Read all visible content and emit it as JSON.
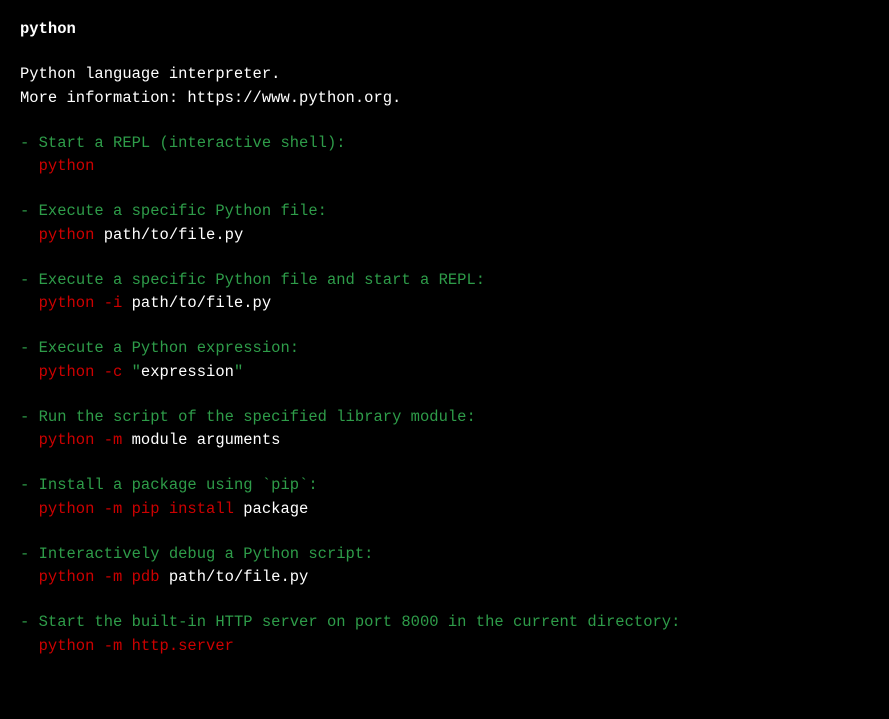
{
  "title": "python",
  "description": {
    "line1": "Python language interpreter.",
    "line2": "More information: https://www.python.org."
  },
  "examples": [
    {
      "desc": "Start a REPL (interactive shell):",
      "cmd": "python",
      "arg": ""
    },
    {
      "desc": "Execute a specific Python file:",
      "cmd": "python ",
      "arg": "path/to/file.py"
    },
    {
      "desc": "Execute a specific Python file and start a REPL:",
      "cmd": "python -i ",
      "arg": "path/to/file.py"
    },
    {
      "desc": "Execute a Python expression:",
      "cmd": "python -c ",
      "quoted_arg": "expression"
    },
    {
      "desc": "Run the script of the specified library module:",
      "cmd": "python -m ",
      "arg": "module arguments"
    },
    {
      "desc": "Install a package using `pip`:",
      "cmd": "python -m pip install ",
      "arg": "package"
    },
    {
      "desc": "Interactively debug a Python script:",
      "cmd": "python -m pdb ",
      "arg": "path/to/file.py"
    },
    {
      "desc": "Start the built-in HTTP server on port 8000 in the current directory:",
      "cmd": "python -m http.server",
      "arg": ""
    }
  ],
  "dash": "- ",
  "quote_char": "\""
}
